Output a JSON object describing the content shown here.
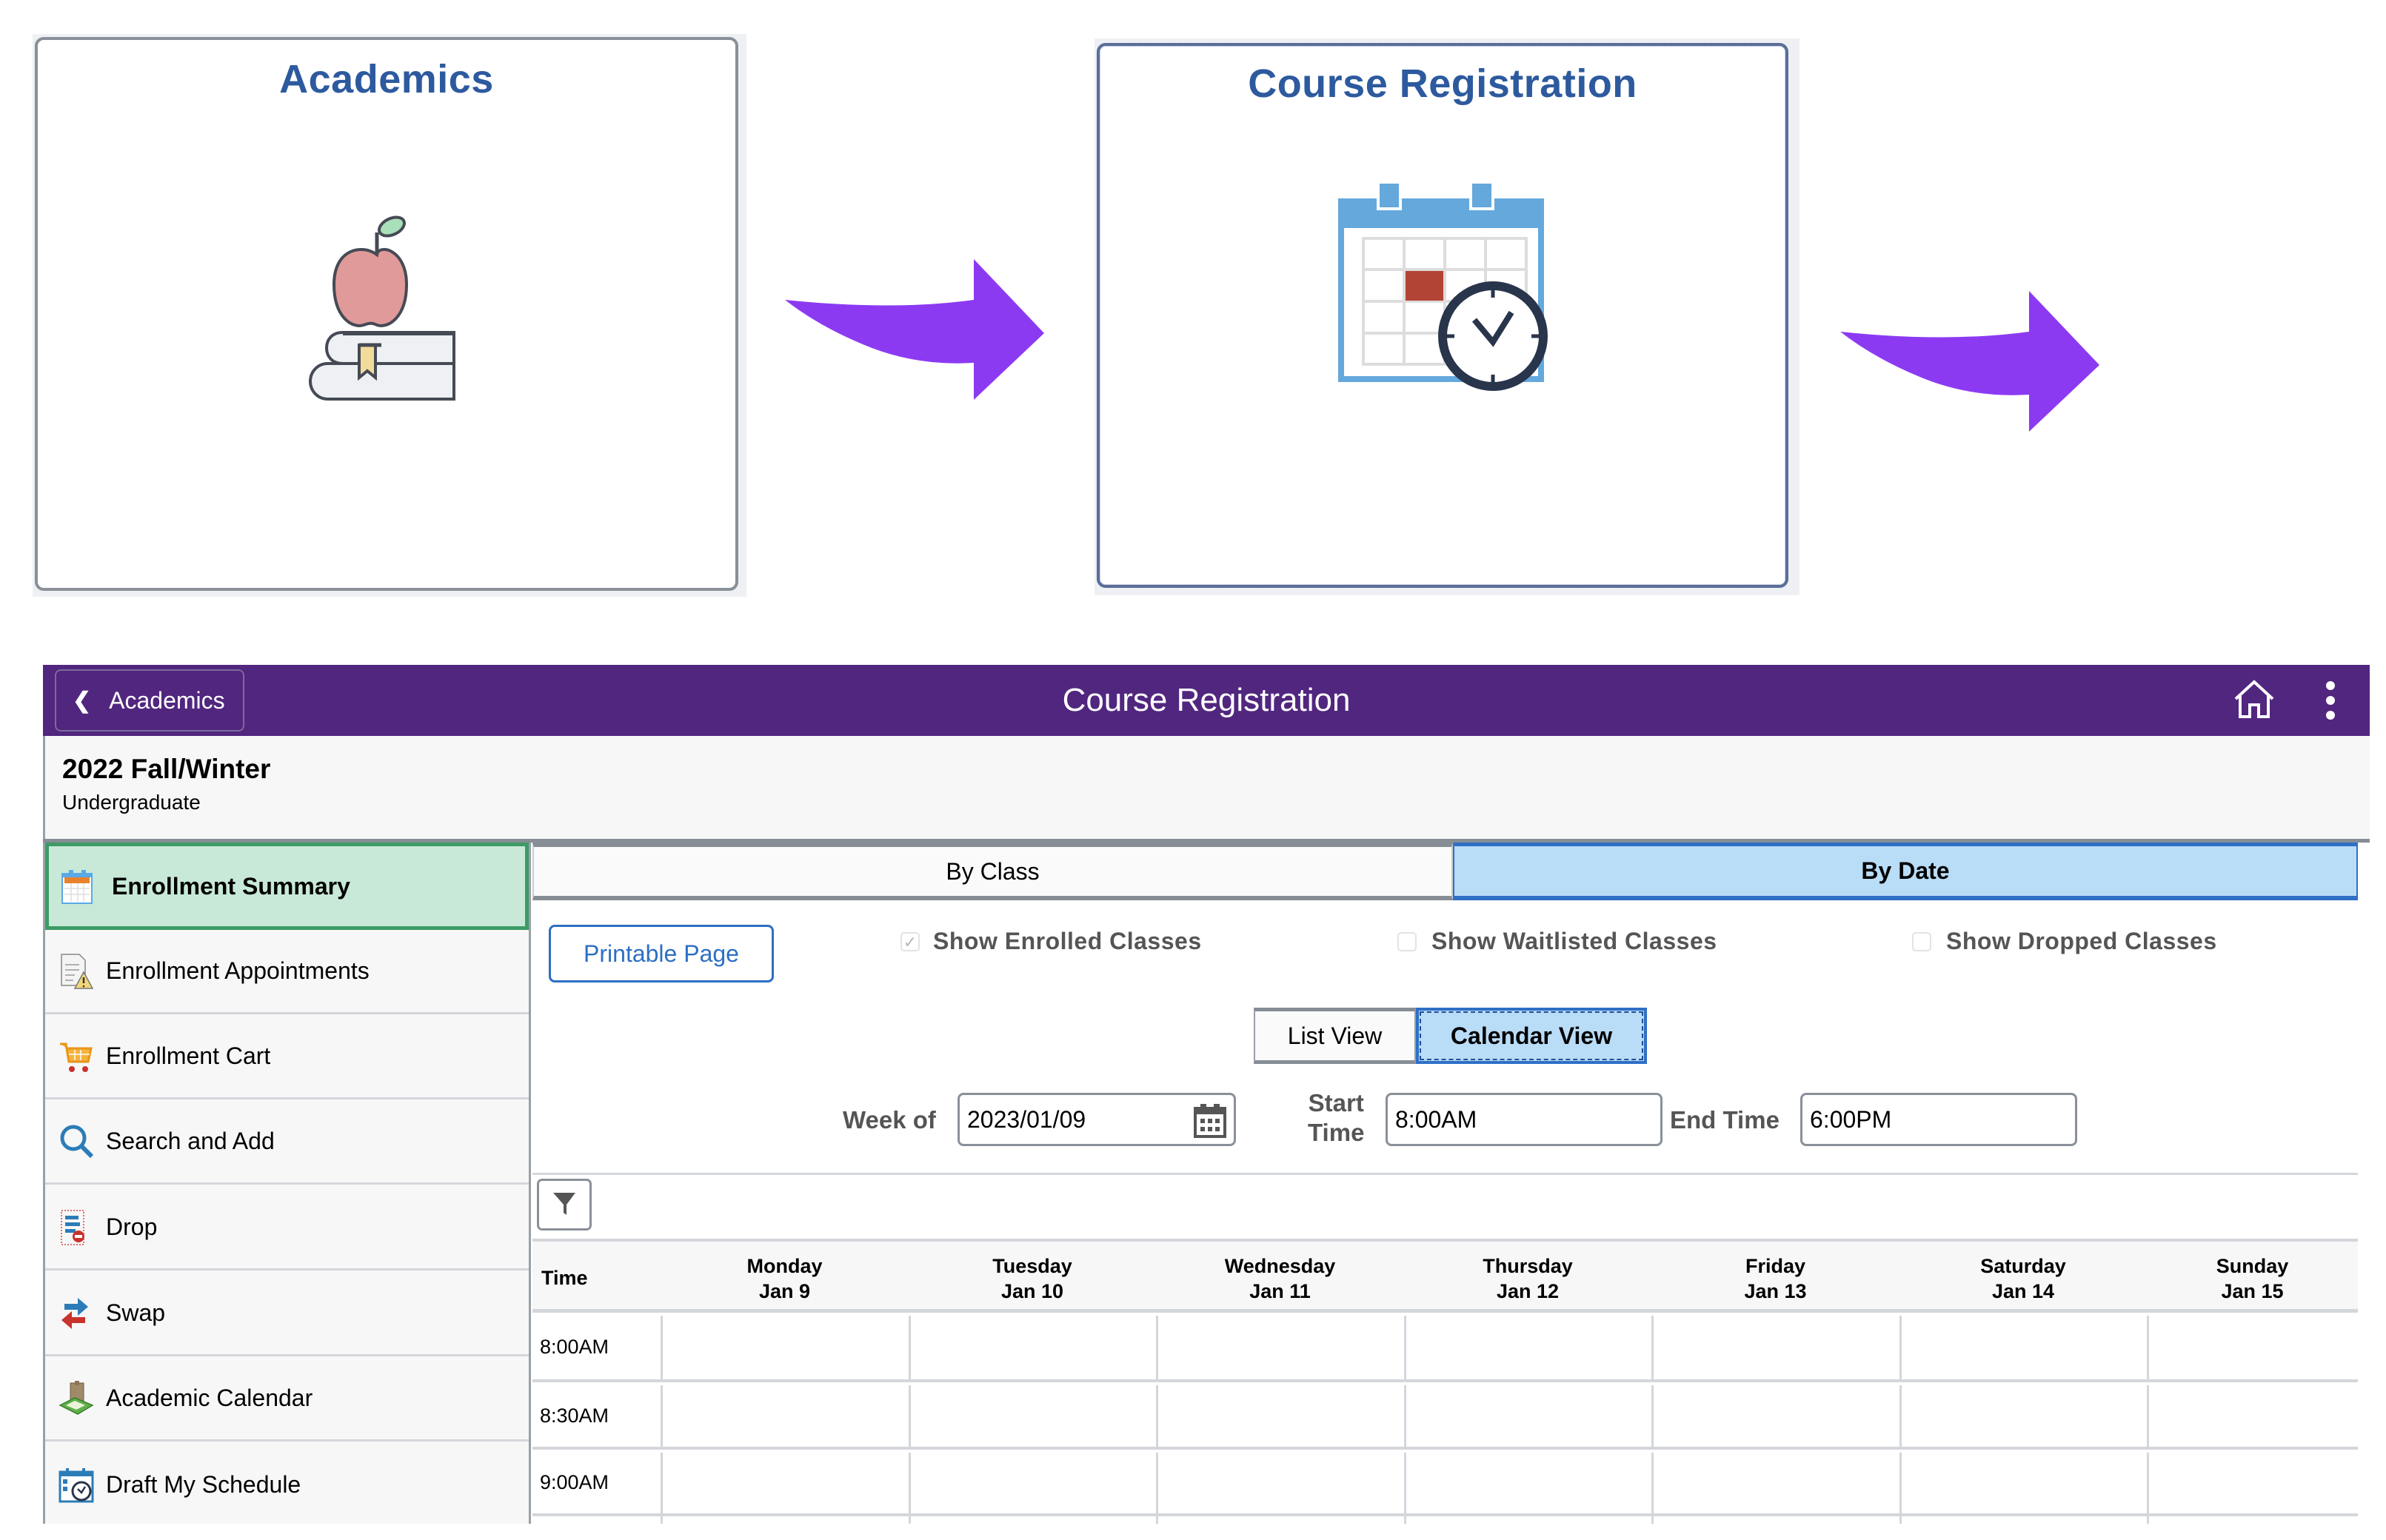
{
  "tiles": {
    "academics": {
      "title": "Academics",
      "icon": "apple-on-books-icon"
    },
    "course_registration": {
      "title": "Course Registration",
      "icon": "calendar-clock-icon"
    }
  },
  "flow_arrows": [
    {
      "icon": "curved-arrow-right-icon",
      "color": "#8c3af2"
    },
    {
      "icon": "curved-arrow-right-icon",
      "color": "#8c3af2"
    }
  ],
  "header": {
    "back_label": "Academics",
    "title": "Course Registration",
    "home_icon": "home-icon",
    "more_icon": "more-vertical-icon",
    "bg_color": "#51267f"
  },
  "context": {
    "term": "2022 Fall/Winter",
    "career": "Undergraduate"
  },
  "sidebar": {
    "items": [
      {
        "label": "Enrollment Summary",
        "icon": "calendar-icon",
        "active": true
      },
      {
        "label": "Enrollment Appointments",
        "icon": "document-warning-icon",
        "active": false
      },
      {
        "label": "Enrollment Cart",
        "icon": "cart-icon",
        "active": false
      },
      {
        "label": "Search and Add",
        "icon": "search-icon",
        "active": false
      },
      {
        "label": "Drop",
        "icon": "drop-icon",
        "active": false
      },
      {
        "label": "Swap",
        "icon": "swap-icon",
        "active": false
      },
      {
        "label": "Academic Calendar",
        "icon": "academic-calendar-icon",
        "active": false
      },
      {
        "label": "Draft My Schedule",
        "icon": "schedule-clock-icon",
        "active": false
      }
    ]
  },
  "tabs": [
    {
      "label": "By Class",
      "selected": false
    },
    {
      "label": "By Date",
      "selected": true
    }
  ],
  "options": {
    "printable_label": "Printable Page",
    "checkboxes": [
      {
        "label": "Show Enrolled Classes",
        "checked": true
      },
      {
        "label": "Show Waitlisted Classes",
        "checked": false
      },
      {
        "label": "Show Dropped Classes",
        "checked": false
      }
    ]
  },
  "view_toggle": {
    "options": [
      {
        "label": "List View",
        "selected": false
      },
      {
        "label": "Calendar View",
        "selected": true
      }
    ]
  },
  "filters": {
    "week_of_label": "Week of",
    "week_of_value": "2023/01/09",
    "start_time_label_1": "Start",
    "start_time_label_2": "Time",
    "start_time_value": "8:00AM",
    "end_time_label": "End Time",
    "end_time_value": "6:00PM"
  },
  "calendar": {
    "time_header": "Time",
    "days": [
      {
        "day": "Monday",
        "date": "Jan 9"
      },
      {
        "day": "Tuesday",
        "date": "Jan 10"
      },
      {
        "day": "Wednesday",
        "date": "Jan 11"
      },
      {
        "day": "Thursday",
        "date": "Jan 12"
      },
      {
        "day": "Friday",
        "date": "Jan 13"
      },
      {
        "day": "Saturday",
        "date": "Jan 14"
      },
      {
        "day": "Sunday",
        "date": "Jan 15"
      }
    ],
    "times": [
      "8:00AM",
      "8:30AM",
      "9:00AM"
    ]
  }
}
